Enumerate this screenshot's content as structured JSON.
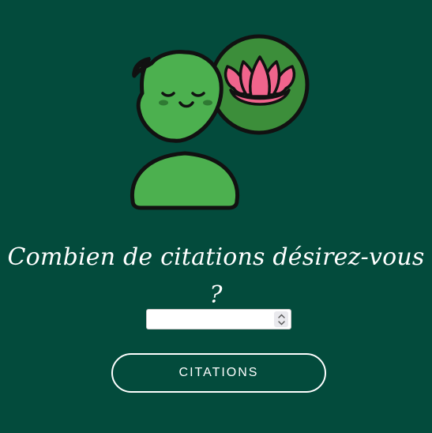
{
  "illustration": {
    "icon": "meditating-person-with-lotus-icon",
    "colors": {
      "figure_green": "#4CB04F",
      "circle_green": "#3C8E3A",
      "lotus_pink": "#F0648C",
      "lotus_dark_pink": "#D94775",
      "outline": "#111111"
    }
  },
  "question": {
    "text": "Combien de citations désirez-vous ?"
  },
  "quantity_input": {
    "value": "",
    "placeholder": ""
  },
  "submit": {
    "label": "CITATIONS"
  },
  "theme": {
    "background": "#034B3C",
    "text": "#FFFFFF"
  }
}
